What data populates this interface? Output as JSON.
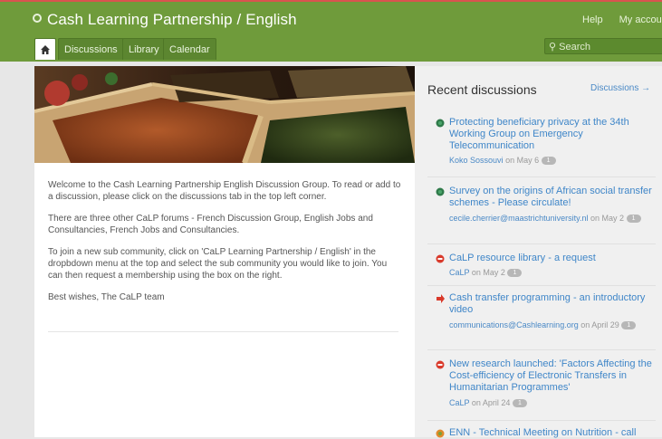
{
  "header": {
    "brand": "Cash Learning Partnership / English",
    "help": "Help",
    "account": "My account",
    "search_placeholder": "Search"
  },
  "tabs": [
    "Discussions",
    "Library",
    "Calendar"
  ],
  "content": {
    "p1": "Welcome to the Cash Learning Partnership English Discussion Group. To read or add to a discussion, please click on the discussions tab in the top left corner.",
    "p2": "There are three other CaLP forums - French Discussion Group, English Jobs and Consultancies, French Jobs and Consultancies.",
    "p3": "To join a new sub community, click on 'CaLP Learning Partnership / English' in the dropbdown menu at the top and select the sub community you would like to join. You can then request a membership using the box on the right.",
    "p4": "Best wishes, The CaLP team"
  },
  "sidebar": {
    "title": "Recent discussions",
    "more_link": "Discussions →",
    "items": [
      {
        "title": "Protecting beneficiary privacy at the 34th Working Group on Emergency Telecommunication",
        "author": "Koko Sossouvi",
        "date": "on May 6",
        "count": "1",
        "icon": "green-dot-icon"
      },
      {
        "title": "Survey on the origins of African social transfer schemes - Please circulate!",
        "author": "cecile.cherrier@maastrichtuniversity.nl",
        "date": "on May 2",
        "count": "1",
        "icon": "green-dot-icon"
      },
      {
        "title": "CaLP resource library - a request",
        "author": "CaLP",
        "date": "on May 2",
        "count": "1",
        "icon": "red-circle-icon"
      },
      {
        "title": "Cash transfer programming - an introductory video",
        "author": "communications@Cashlearning.org",
        "date": "on April 29",
        "count": "1",
        "icon": "red-arrow-icon"
      },
      {
        "title": "New research launched: 'Factors Affecting the Cost-efficiency of Electronic Transfers in Humanitarian Programmes'",
        "author": "CaLP",
        "date": "on April 24",
        "count": "1",
        "icon": "red-circle-icon"
      },
      {
        "title": "ENN - Technical Meeting on Nutrition - call",
        "author": "",
        "date": "",
        "count": "",
        "icon": "orange-dot-icon"
      }
    ]
  },
  "colors": {
    "header_green": "#6f9b3b",
    "link_blue": "#3f86c8"
  }
}
